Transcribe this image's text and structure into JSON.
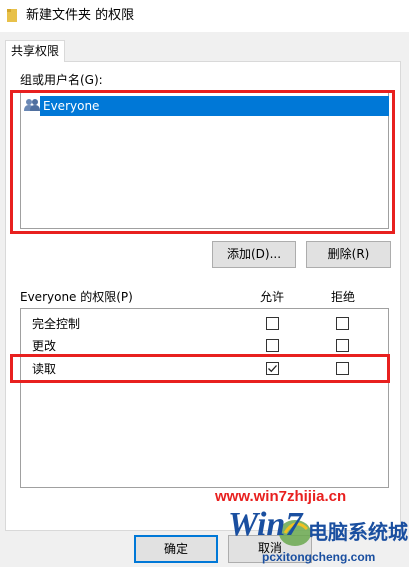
{
  "window": {
    "title": "新建文件夹 的权限"
  },
  "tabs": [
    {
      "label": "共享权限"
    }
  ],
  "groups": {
    "label": "组或用户名(G):",
    "items": [
      {
        "name": "Everyone",
        "icon": "users-icon",
        "selected": true
      }
    ]
  },
  "buttons": {
    "add": "添加(D)...",
    "remove": "删除(R)",
    "ok": "确定",
    "cancel": "取消"
  },
  "permissions": {
    "label": "Everyone 的权限(P)",
    "allow_header": "允许",
    "deny_header": "拒绝",
    "rows": [
      {
        "name": "完全控制",
        "allow": false,
        "deny": false
      },
      {
        "name": "更改",
        "allow": false,
        "deny": false
      },
      {
        "name": "读取",
        "allow": true,
        "deny": false
      }
    ]
  },
  "watermark": {
    "url": "www.win7zhijia.cn",
    "logo": "Win7",
    "brand": "电脑系统城",
    "domain": "pcxitongcheng.com"
  },
  "colors": {
    "selection": "#0078d7",
    "highlight": "#e8201f",
    "watermark": "#1a4fa0"
  }
}
